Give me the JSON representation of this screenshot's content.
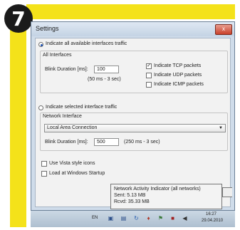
{
  "step_badge": "7",
  "window": {
    "title": "Settings",
    "close_label": "x"
  },
  "all_interfaces": {
    "radio_label": "Indicate all available interfaces traffic",
    "group_label": "All Interfaces",
    "blink_label": "Blink Duration [ms]:",
    "blink_value": "100",
    "blink_hint": "(50 ms - 3 sec)",
    "tcp_label": "Indicate TCP packets",
    "udp_label": "Indicate UDP packets",
    "icmp_label": "Indicate ICMP packets"
  },
  "selected_interface": {
    "radio_label": "Indicate selected interface traffic",
    "group_label": "Network Interface",
    "interface_value": "Local Area Connection",
    "blink_label": "Blink Duration [ms]:",
    "blink_value": "500",
    "blink_hint": "(250 ms - 3 sec)"
  },
  "options": {
    "vista_icons_label": "Use Vista style icons",
    "startup_label": "Load at Windows Startup"
  },
  "tooltip": {
    "title": "Network Activity Indicator (all networks)",
    "sent": "Sent: 5.13 MB",
    "rcvd": "Rcvd: 35.33 MB"
  },
  "taskbar": {
    "language": "EN",
    "time": "16:27",
    "date": "29.04.2010"
  }
}
